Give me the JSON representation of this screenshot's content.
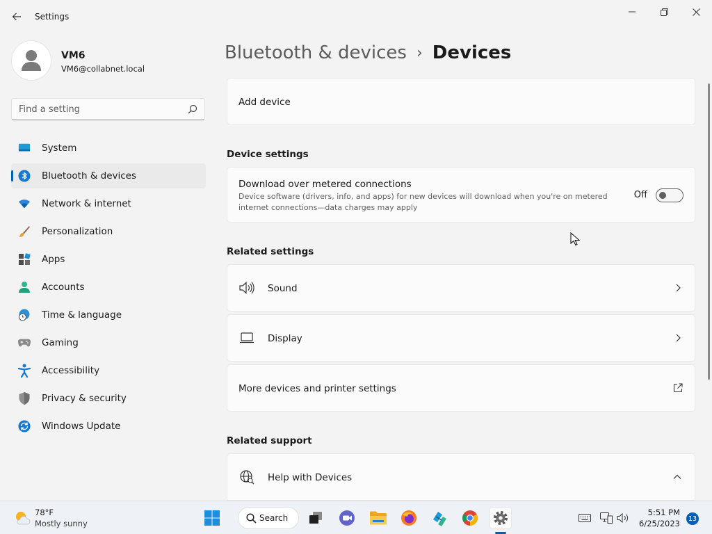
{
  "window": {
    "title": "Settings"
  },
  "profile": {
    "name": "VM6",
    "email": "VM6@collabnet.local"
  },
  "search": {
    "placeholder": "Find a setting"
  },
  "sidebar": {
    "items": [
      {
        "label": "System",
        "icon": "system-icon"
      },
      {
        "label": "Bluetooth & devices",
        "icon": "bluetooth-icon",
        "selected": true
      },
      {
        "label": "Network & internet",
        "icon": "wifi-icon"
      },
      {
        "label": "Personalization",
        "icon": "brush-icon"
      },
      {
        "label": "Apps",
        "icon": "apps-icon"
      },
      {
        "label": "Accounts",
        "icon": "person-icon"
      },
      {
        "label": "Time & language",
        "icon": "globe-clock-icon"
      },
      {
        "label": "Gaming",
        "icon": "gamepad-icon"
      },
      {
        "label": "Accessibility",
        "icon": "accessibility-icon"
      },
      {
        "label": "Privacy & security",
        "icon": "shield-icon"
      },
      {
        "label": "Windows Update",
        "icon": "update-icon"
      }
    ]
  },
  "breadcrumb": {
    "parent": "Bluetooth & devices",
    "separator": "›",
    "current": "Devices"
  },
  "main": {
    "add_device": "Add device",
    "device_settings_heading": "Device settings",
    "metered": {
      "title": "Download over metered connections",
      "description": "Device software (drivers, info, and apps) for new devices will download when you're on metered internet connections—data charges may apply",
      "toggle_label": "Off",
      "toggle_on": false
    },
    "related_settings_heading": "Related settings",
    "related": [
      {
        "label": "Sound",
        "icon": "speaker-icon"
      },
      {
        "label": "Display",
        "icon": "laptop-icon"
      },
      {
        "label": "More devices and printer settings",
        "icon": "external-link-icon"
      }
    ],
    "related_support_heading": "Related support",
    "help": {
      "label": "Help with Devices",
      "icon": "globe-icon"
    }
  },
  "taskbar": {
    "weather_temp": "78°F",
    "weather_desc": "Mostly sunny",
    "search_label": "Search",
    "time": "5:51 PM",
    "date": "6/25/2023",
    "notification_count": "13"
  },
  "colors": {
    "accent": "#005fb8",
    "background": "#f3f3f3",
    "card": "#fbfbfb"
  }
}
